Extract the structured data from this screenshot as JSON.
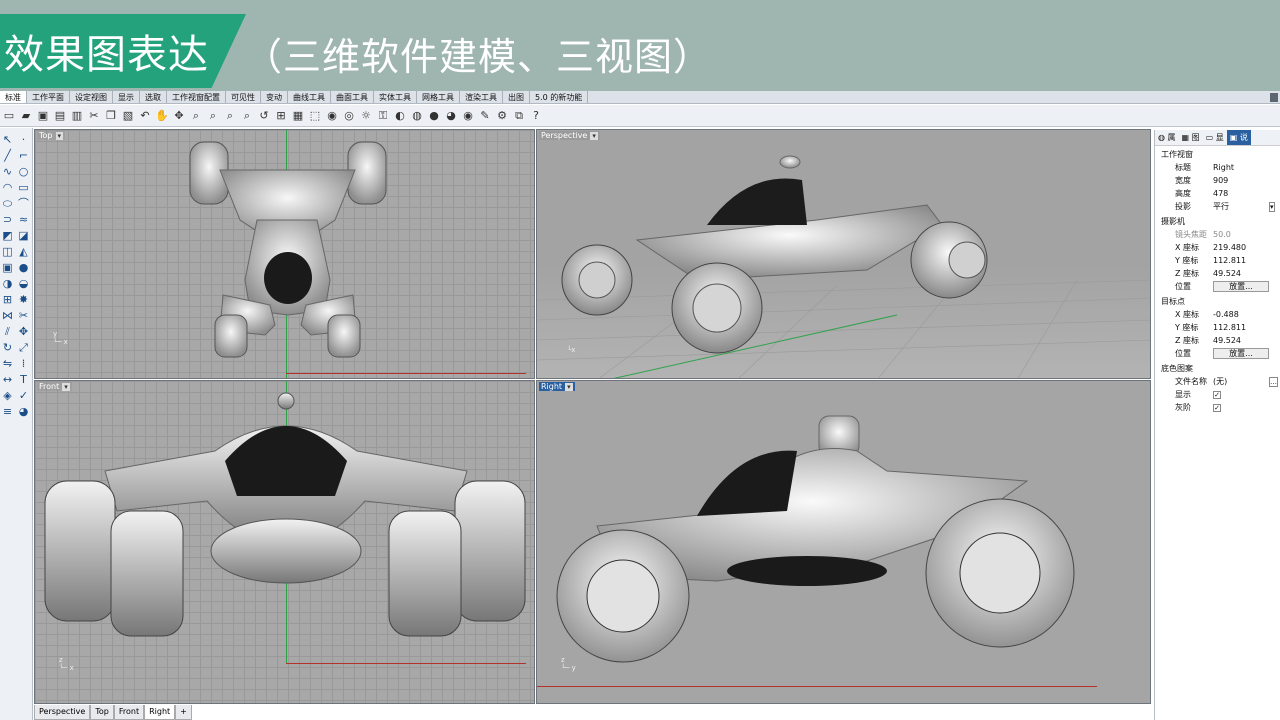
{
  "banner": {
    "title": "效果图表达",
    "subtitle": "（三维软件建模、三视图）"
  },
  "menu_tabs": [
    "标准",
    "工作平面",
    "设定视图",
    "显示",
    "选取",
    "工作视窗配置",
    "可见性",
    "变动",
    "曲线工具",
    "曲面工具",
    "实体工具",
    "网格工具",
    "渲染工具",
    "出图",
    "5.0 的新功能"
  ],
  "viewports": {
    "top": {
      "label": "Top"
    },
    "perspective": {
      "label": "Perspective"
    },
    "front": {
      "label": "Front"
    },
    "right": {
      "label": "Right"
    }
  },
  "bottom_tabs": [
    "Perspective",
    "Top",
    "Front",
    "Right",
    "+"
  ],
  "properties": {
    "section_viewport": "工作视窗",
    "title_label": "标题",
    "title_value": "Right",
    "width_label": "宽度",
    "width_value": "909",
    "height_label": "高度",
    "height_value": "478",
    "proj_label": "投影",
    "proj_value": "平行",
    "section_camera": "摄影机",
    "lens_label": "镜头焦距",
    "lens_value": "50.0",
    "cx_label": "X 座标",
    "cx_value": "219.480",
    "cy_label": "Y 座标",
    "cy_value": "112.811",
    "cz_label": "Z 座标",
    "cz_value": "49.524",
    "pos_label": "位置",
    "place_btn": "放置...",
    "section_target": "目标点",
    "tx_label": "X 座标",
    "tx_value": "-0.488",
    "ty_label": "Y 座标",
    "ty_value": "112.811",
    "tz_label": "Z 座标",
    "tz_value": "49.524",
    "tpos_label": "位置",
    "tplace_btn": "放置...",
    "section_bg": "底色图案",
    "file_label": "文件名称",
    "file_value": "(无)",
    "show_label": "显示",
    "gray_label": "灰阶"
  }
}
